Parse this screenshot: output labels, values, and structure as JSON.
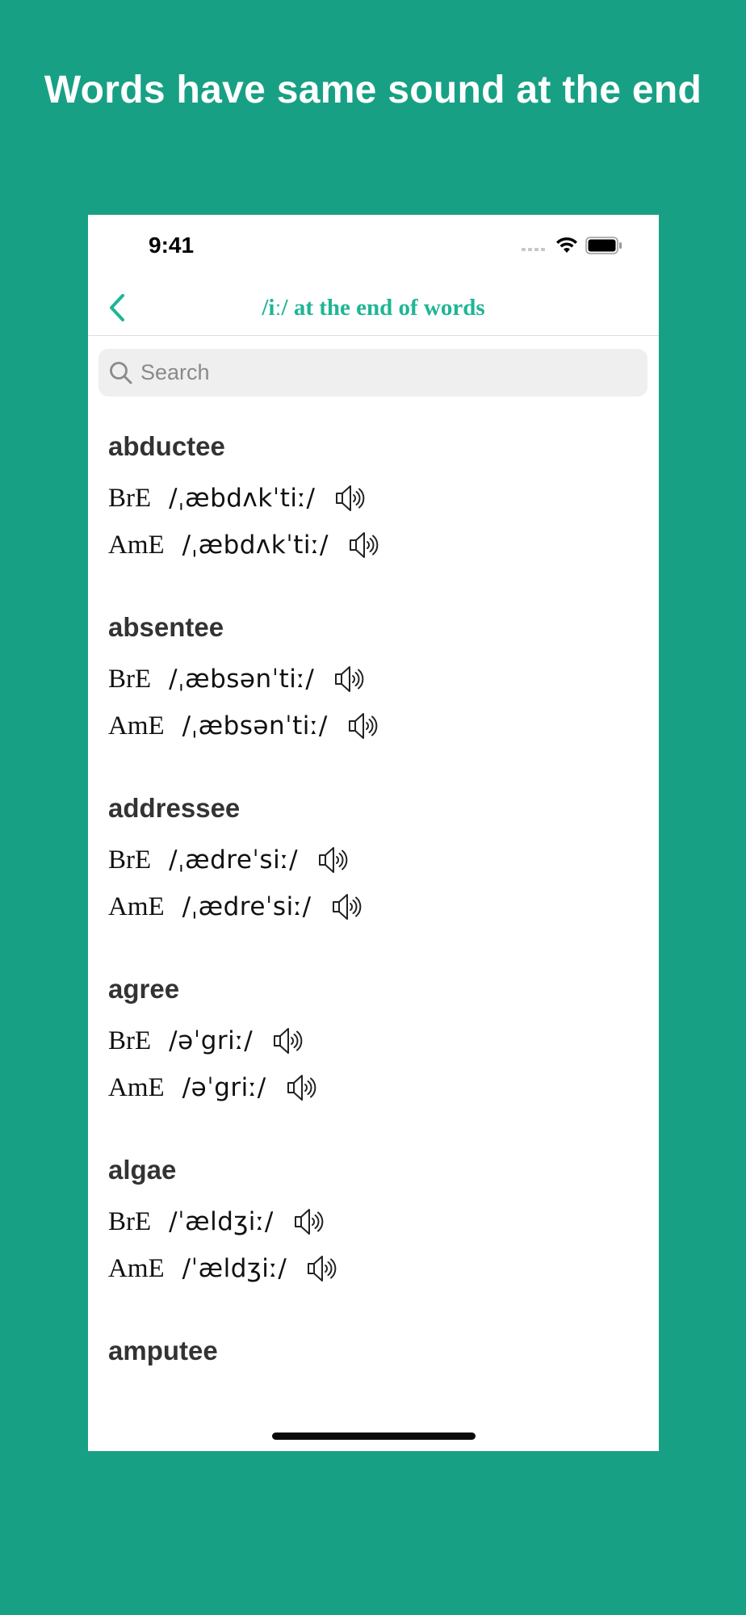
{
  "headline": "Words have same sound at the end",
  "status_bar": {
    "time": "9:41"
  },
  "nav": {
    "title": "/iː/ at the end of words"
  },
  "search": {
    "placeholder": "Search",
    "value": ""
  },
  "dialect_labels": {
    "british": "BrE",
    "american": "AmE"
  },
  "entries": [
    {
      "word": "abductee",
      "bre": "/ˌæbdʌkˈtiː/",
      "ame": "/ˌæbdʌkˈtiː/"
    },
    {
      "word": "absentee",
      "bre": "/ˌæbsənˈtiː/",
      "ame": "/ˌæbsənˈtiː/"
    },
    {
      "word": "addressee",
      "bre": "/ˌædreˈsiː/",
      "ame": "/ˌædreˈsiː/"
    },
    {
      "word": "agree",
      "bre": "/əˈgriː/",
      "ame": "/əˈgriː/"
    },
    {
      "word": "algae",
      "bre": "/ˈældʒiː/",
      "ame": "/ˈældʒiː/"
    },
    {
      "word": "amputee",
      "bre": "",
      "ame": ""
    }
  ],
  "colors": {
    "background": "#18a085",
    "accent": "#1fb595"
  },
  "icons": {
    "back": "chevron-left-icon",
    "search": "magnifier-icon",
    "speaker": "speaker-icon",
    "wifi": "wifi-icon",
    "battery": "battery-icon"
  }
}
